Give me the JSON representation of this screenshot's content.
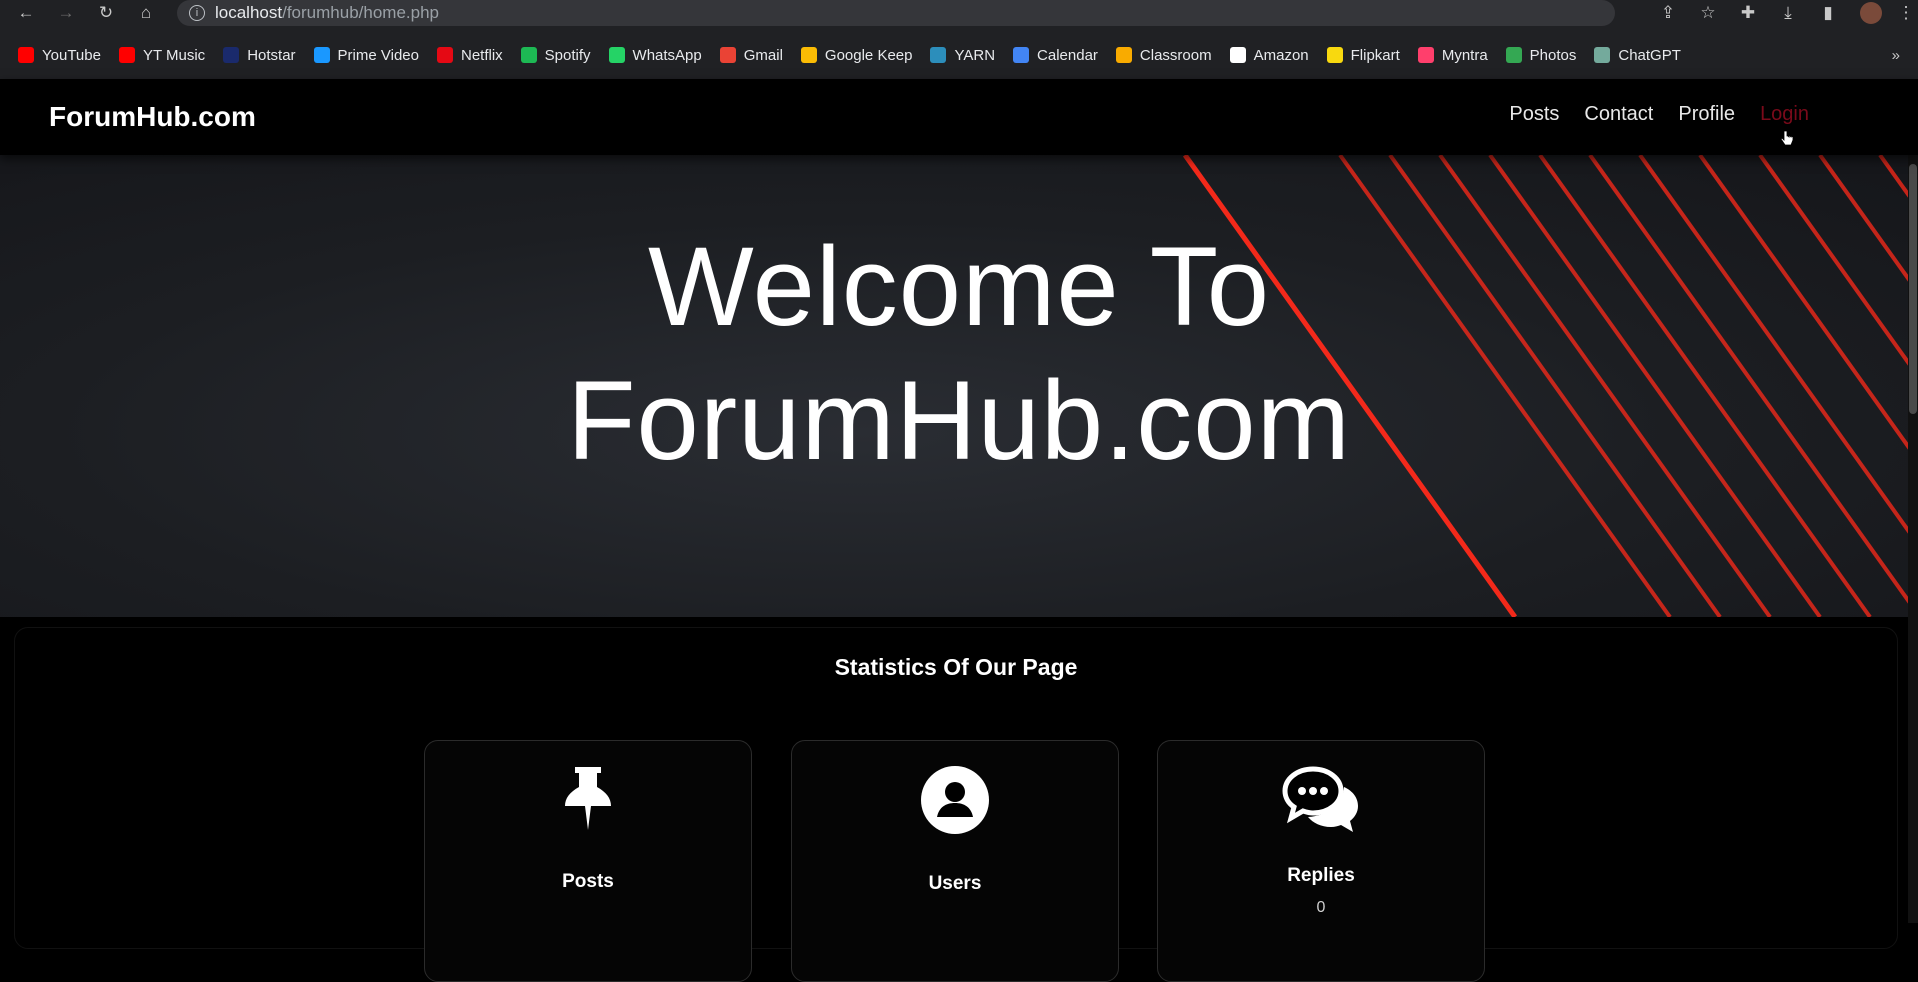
{
  "browser": {
    "url_host": "localhost",
    "url_path": "/forumhub/home.php",
    "bookmarks": [
      {
        "label": "YouTube",
        "icon": "youtube-icon",
        "color": "#ff0000"
      },
      {
        "label": "YT Music",
        "icon": "yt-music-icon",
        "color": "#ff0000"
      },
      {
        "label": "Hotstar",
        "icon": "hotstar-icon",
        "color": "#1a2a6c"
      },
      {
        "label": "Prime Video",
        "icon": "prime-video-icon",
        "color": "#1a98ff"
      },
      {
        "label": "Netflix",
        "icon": "netflix-icon",
        "color": "#e50914"
      },
      {
        "label": "Spotify",
        "icon": "spotify-icon",
        "color": "#1db954"
      },
      {
        "label": "WhatsApp",
        "icon": "whatsapp-icon",
        "color": "#25d366"
      },
      {
        "label": "Gmail",
        "icon": "gmail-icon",
        "color": "#ea4335"
      },
      {
        "label": "Google Keep",
        "icon": "google-keep-icon",
        "color": "#fbbc04"
      },
      {
        "label": "YARN",
        "icon": "yarn-icon",
        "color": "#2c8ebb"
      },
      {
        "label": "Calendar",
        "icon": "calendar-icon",
        "color": "#4285f4"
      },
      {
        "label": "Classroom",
        "icon": "classroom-icon",
        "color": "#f9ab00"
      },
      {
        "label": "Amazon",
        "icon": "amazon-icon",
        "color": "#ffffff"
      },
      {
        "label": "Flipkart",
        "icon": "flipkart-icon",
        "color": "#f8d90f"
      },
      {
        "label": "Myntra",
        "icon": "myntra-icon",
        "color": "#ff3f6c"
      },
      {
        "label": "Photos",
        "icon": "photos-icon",
        "color": "#34a853"
      },
      {
        "label": "ChatGPT",
        "icon": "chatgpt-icon",
        "color": "#74aa9c"
      }
    ],
    "more_label": "»"
  },
  "site": {
    "brand": "ForumHub.com",
    "menu": {
      "posts": "Posts",
      "contact": "Contact",
      "profile": "Profile",
      "login": "Login"
    },
    "login_color": "#7a0a1a"
  },
  "hero": {
    "line1": "Welcome To",
    "line2": "ForumHub.com",
    "accent_color": "#ff2a1a"
  },
  "stats": {
    "title": "Statistics Of Our Page",
    "cards": [
      {
        "label": "Posts",
        "icon": "pushpin-icon"
      },
      {
        "label": "Users",
        "icon": "user-circle-icon"
      },
      {
        "label": "Replies",
        "icon": "comments-icon",
        "count": "0"
      }
    ]
  }
}
